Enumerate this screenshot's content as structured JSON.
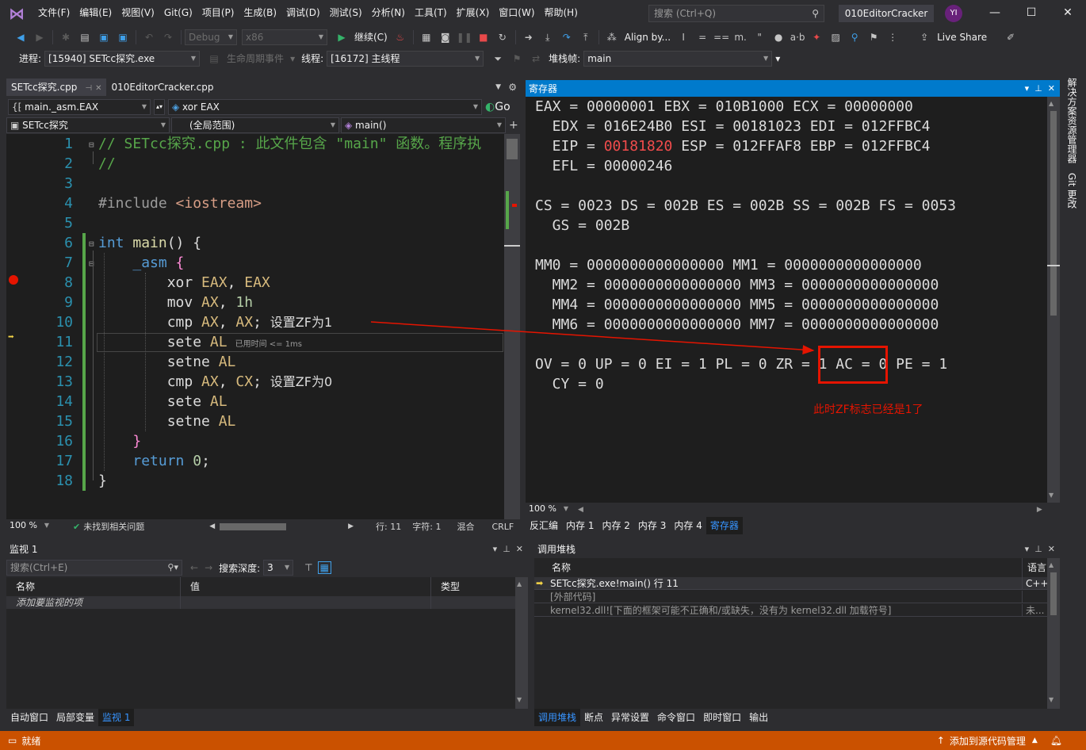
{
  "menu": [
    "文件(F)",
    "编辑(E)",
    "视图(V)",
    "Git(G)",
    "项目(P)",
    "生成(B)",
    "调试(D)",
    "测试(S)",
    "分析(N)",
    "工具(T)",
    "扩展(X)",
    "窗口(W)",
    "帮助(H)"
  ],
  "search": {
    "placeholder": "搜索 (Ctrl+Q)"
  },
  "solution_title": "010EditorCracker",
  "avatar": "YI",
  "toolbar1": {
    "config": "Debug",
    "platform": "x86",
    "continue": "继续(C)",
    "align": "Align by...",
    "live_share": "Live Share"
  },
  "toolbar2": {
    "process_label": "进程:",
    "process": "[15940] SETcc探究.exe",
    "lifecycle": "生命周期事件",
    "thread_label": "线程:",
    "thread": "[16172] 主线程",
    "stack_label": "堆栈帧:",
    "stack": "main"
  },
  "editor": {
    "tabs": [
      {
        "label": "SETcc探究.cpp",
        "active": true
      },
      {
        "label": "010EditorCracker.cpp",
        "active": false
      }
    ],
    "nav_scope": "main._asm.EAX",
    "nav_member": "xor EAX",
    "nav_go": "Go",
    "nav_project": "SETcc探究",
    "nav_global": "(全局范围)",
    "nav_func": "main()",
    "zoom": "100 %",
    "issues": "未找到相关问题",
    "line": "行: 11",
    "char": "字符: 1",
    "mixed": "混合",
    "eol": "CRLF",
    "elapsed": "已用时间 <= 1ms",
    "lines": [
      {
        "n": "1",
        "parts": [
          [
            "cm",
            "// SETcc探究.cpp : 此文件包含 \"main\" 函数。程序执"
          ]
        ]
      },
      {
        "n": "2",
        "parts": [
          [
            "cm",
            "//"
          ]
        ]
      },
      {
        "n": "3",
        "parts": []
      },
      {
        "n": "4",
        "parts": [
          [
            "inc",
            "#include "
          ],
          [
            "str",
            "<iostream>"
          ]
        ]
      },
      {
        "n": "5",
        "parts": []
      },
      {
        "n": "6",
        "parts": [
          [
            "kw",
            "int "
          ],
          [
            "fn",
            "main"
          ],
          [
            "plain",
            "() {"
          ]
        ]
      },
      {
        "n": "7",
        "parts": [
          [
            "plain",
            "    "
          ],
          [
            "kw",
            "_asm "
          ],
          [
            "brace",
            "{"
          ]
        ]
      },
      {
        "n": "8",
        "parts": [
          [
            "plain",
            "        xor "
          ],
          [
            "reg",
            "EAX"
          ],
          [
            "plain",
            ", "
          ],
          [
            "reg",
            "EAX"
          ]
        ]
      },
      {
        "n": "9",
        "parts": [
          [
            "plain",
            "        mov "
          ],
          [
            "reg",
            "AX"
          ],
          [
            "plain",
            ", "
          ],
          [
            "num",
            "1h"
          ]
        ]
      },
      {
        "n": "10",
        "parts": [
          [
            "plain",
            "        cmp "
          ],
          [
            "reg",
            "AX"
          ],
          [
            "plain",
            ", "
          ],
          [
            "reg",
            "AX"
          ],
          [
            "plain",
            "; "
          ],
          [
            "note",
            "设置ZF为1"
          ]
        ]
      },
      {
        "n": "11",
        "parts": [
          [
            "plain",
            "        sete "
          ],
          [
            "reg",
            "AL"
          ]
        ]
      },
      {
        "n": "12",
        "parts": [
          [
            "plain",
            "        setne "
          ],
          [
            "reg",
            "AL"
          ]
        ]
      },
      {
        "n": "13",
        "parts": [
          [
            "plain",
            "        cmp "
          ],
          [
            "reg",
            "AX"
          ],
          [
            "plain",
            ", "
          ],
          [
            "reg",
            "CX"
          ],
          [
            "plain",
            "; "
          ],
          [
            "note",
            "设置ZF为0"
          ]
        ]
      },
      {
        "n": "14",
        "parts": [
          [
            "plain",
            "        sete "
          ],
          [
            "reg",
            "AL"
          ]
        ]
      },
      {
        "n": "15",
        "parts": [
          [
            "plain",
            "        setne "
          ],
          [
            "reg",
            "AL"
          ]
        ]
      },
      {
        "n": "16",
        "parts": [
          [
            "plain",
            "    "
          ],
          [
            "brace",
            "}"
          ]
        ]
      },
      {
        "n": "17",
        "parts": [
          [
            "plain",
            "    "
          ],
          [
            "kw",
            "return "
          ],
          [
            "num",
            "0"
          ],
          [
            "plain",
            ";"
          ]
        ]
      },
      {
        "n": "18",
        "parts": [
          [
            "plain",
            "}"
          ]
        ]
      }
    ]
  },
  "registers": {
    "title": "寄存器",
    "lines": [
      [
        [
          "",
          "EAX = 00000001 EBX = 010B1000 ECX = 00000000"
        ]
      ],
      [
        [
          "",
          "  EDX = 016E24B0 ESI = 00181023 EDI = 012FFBC4"
        ]
      ],
      [
        [
          "",
          "  EIP = "
        ],
        [
          "red",
          "00181820"
        ],
        [
          "",
          " ESP = 012FFAF8 EBP = 012FFBC4"
        ]
      ],
      [
        [
          "",
          "  EFL = 00000246"
        ]
      ],
      [
        [
          "",
          ""
        ]
      ],
      [
        [
          "",
          "CS = 0023 DS = 002B ES = 002B SS = 002B FS = 0053"
        ]
      ],
      [
        [
          "",
          "  GS = 002B"
        ]
      ],
      [
        [
          "",
          ""
        ]
      ],
      [
        [
          "",
          "MM0 = 0000000000000000 MM1 = 0000000000000000"
        ]
      ],
      [
        [
          "",
          "  MM2 = 0000000000000000 MM3 = 0000000000000000"
        ]
      ],
      [
        [
          "",
          "  MM4 = 0000000000000000 MM5 = 0000000000000000"
        ]
      ],
      [
        [
          "",
          "  MM6 = 0000000000000000 MM7 = 0000000000000000"
        ]
      ],
      [
        [
          "",
          ""
        ]
      ],
      [
        [
          "",
          "OV = 0 UP = 0 EI = 1 PL = 0 ZR = 1 AC = 0 PE = 1"
        ]
      ],
      [
        [
          "",
          "  CY = 0"
        ]
      ]
    ],
    "annotation": "此时ZF标志已经是1了",
    "zoom": "100 %",
    "tabs": [
      "反汇编",
      "内存 1",
      "内存 2",
      "内存 3",
      "内存 4",
      "寄存器"
    ]
  },
  "side_tabs": [
    "解决方案资源管理器",
    "Git 更改"
  ],
  "watch": {
    "title": "监视 1",
    "search_placeholder": "搜索(Ctrl+E)",
    "depth_label": "搜索深度:",
    "depth": "3",
    "columns": [
      "名称",
      "值",
      "类型"
    ],
    "add_item": "添加要监视的项",
    "tabs": [
      "自动窗口",
      "局部变量",
      "监视 1"
    ]
  },
  "callstack": {
    "title": "调用堆栈",
    "columns": [
      "名称",
      "语言"
    ],
    "rows": [
      {
        "name": "SETcc探究.exe!main() 行 11",
        "lang": "C++",
        "current": true
      },
      {
        "name": "[外部代码]",
        "lang": "",
        "current": false
      },
      {
        "name": "kernel32.dll![下面的框架可能不正确和/或缺失，没有为 kernel32.dll 加载符号]",
        "lang": "未...",
        "current": false
      }
    ],
    "tabs": [
      "调用堆栈",
      "断点",
      "异常设置",
      "命令窗口",
      "即时窗口",
      "输出"
    ]
  },
  "status": {
    "ready": "就绪",
    "source_control": "添加到源代码管理"
  },
  "colors": {
    "accent": "#007acc",
    "status": "#ca5100",
    "annotation": "#e51400"
  }
}
